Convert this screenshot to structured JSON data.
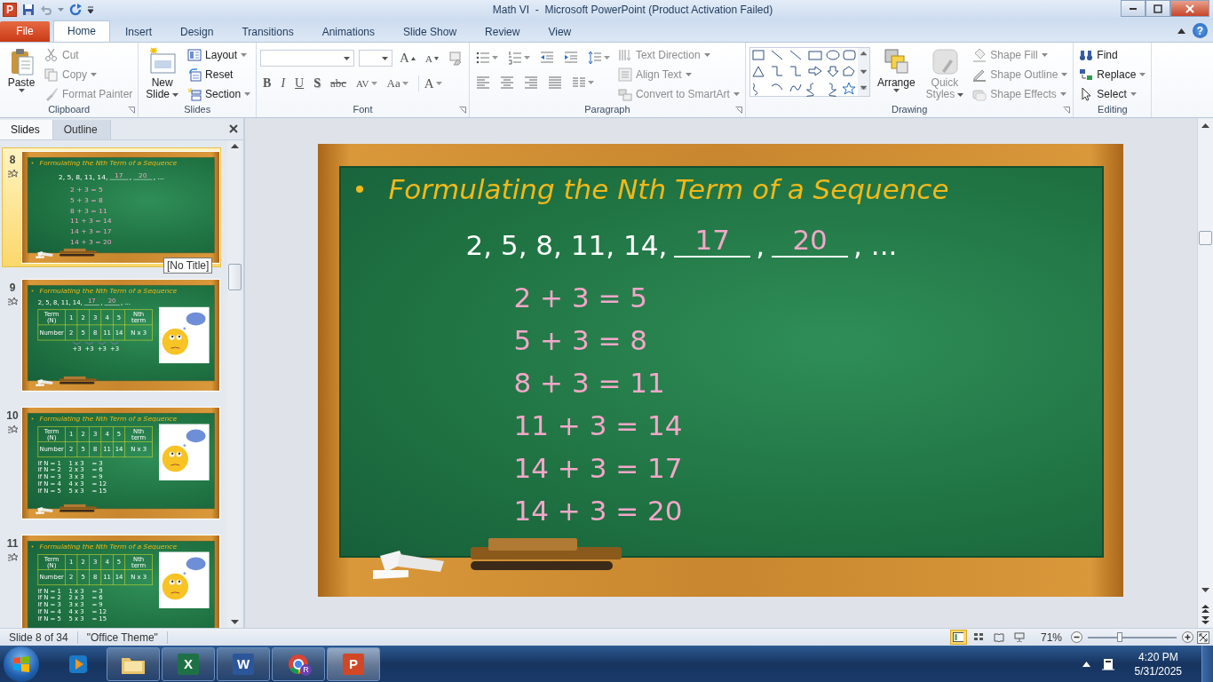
{
  "window": {
    "title": "Math VI  -  Microsoft PowerPoint (Product Activation Failed)",
    "app_glyph": "P"
  },
  "tabs": [
    {
      "label": "File",
      "kind": "file",
      "selected": false
    },
    {
      "label": "Home",
      "kind": "tab",
      "selected": true
    },
    {
      "label": "Insert",
      "kind": "tab",
      "selected": false
    },
    {
      "label": "Design",
      "kind": "tab",
      "selected": false
    },
    {
      "label": "Transitions",
      "kind": "tab",
      "selected": false
    },
    {
      "label": "Animations",
      "kind": "tab",
      "selected": false
    },
    {
      "label": "Slide Show",
      "kind": "tab",
      "selected": false
    },
    {
      "label": "Review",
      "kind": "tab",
      "selected": false
    },
    {
      "label": "View",
      "kind": "tab",
      "selected": false
    }
  ],
  "help": "?",
  "ribbon": [
    {
      "label": "Clipboard",
      "dialog_launcher": true,
      "columns": [
        {
          "kind": "large",
          "items": [
            {
              "label": "Paste",
              "disabled": false,
              "dropdown": true
            }
          ]
        },
        {
          "kind": "stack",
          "items": [
            {
              "label": "Cut",
              "disabled": true,
              "dropdown": false
            },
            {
              "label": "Copy",
              "disabled": true,
              "dropdown": true
            },
            {
              "label": "Format Painter",
              "disabled": true,
              "dropdown": false
            }
          ]
        }
      ]
    },
    {
      "label": "Slides",
      "dialog_launcher": false,
      "columns": [
        {
          "kind": "large",
          "items": [
            {
              "label": "New Slide",
              "disabled": false,
              "dropdown": true
            }
          ]
        },
        {
          "kind": "stack",
          "items": [
            {
              "label": "Layout",
              "disabled": false,
              "dropdown": true
            },
            {
              "label": "Reset",
              "disabled": false,
              "dropdown": false
            },
            {
              "label": "Section",
              "disabled": false,
              "dropdown": true
            }
          ]
        }
      ]
    },
    {
      "label": "Font",
      "dialog_launcher": true,
      "columns": [
        {
          "kind": "rows",
          "rows": [
            {
              "items": [
                {
                  "kind": "font-combo",
                  "dropdown": true
                },
                {
                  "kind": "size-combo",
                  "dropdown": true
                },
                {
                  "kind": "grow",
                  "label": "A",
                  "dropdown": false
                },
                {
                  "kind": "shrink",
                  "label": "A",
                  "dropdown": false
                },
                {
                  "kind": "clear",
                  "dropdown": false
                }
              ]
            },
            {
              "items": [
                {
                  "kind": "bold",
                  "label": "B",
                  "dropdown": false
                },
                {
                  "kind": "italic",
                  "label": "I",
                  "dropdown": false
                },
                {
                  "kind": "underline",
                  "label": "U",
                  "dropdown": false
                },
                {
                  "kind": "shadow",
                  "label": "S",
                  "dropdown": false
                },
                {
                  "kind": "strike",
                  "label": "abc",
                  "dropdown": false
                },
                {
                  "kind": "spacing",
                  "label": "AV",
                  "dropdown": true
                },
                {
                  "kind": "case",
                  "label": "Aa",
                  "dropdown": true
                },
                {
                  "kind": "color",
                  "label": "A",
                  "dropdown": true
                }
              ]
            }
          ]
        }
      ]
    },
    {
      "label": "Paragraph",
      "dialog_launcher": true,
      "columns": [
        {
          "kind": "rows",
          "rows": [
            {
              "items": [
                {
                  "kind": "bullets",
                  "dropdown": true
                },
                {
                  "kind": "numbering",
                  "dropdown": true
                },
                {
                  "kind": "outdent",
                  "dropdown": false
                },
                {
                  "kind": "indent",
                  "dropdown": false
                },
                {
                  "kind": "line-spacing",
                  "dropdown": true
                }
              ]
            },
            {
              "items": [
                {
                  "kind": "align-left",
                  "dropdown": false
                },
                {
                  "kind": "center",
                  "dropdown": false
                },
                {
                  "kind": "align-right",
                  "dropdown": false
                },
                {
                  "kind": "justify",
                  "dropdown": false
                },
                {
                  "kind": "columns",
                  "dropdown": true
                }
              ]
            }
          ]
        },
        {
          "kind": "stack",
          "items": [
            {
              "label": "Text Direction",
              "disabled": true,
              "dropdown": true
            },
            {
              "label": "Align Text",
              "disabled": true,
              "dropdown": true
            },
            {
              "label": "Convert to SmartArt",
              "disabled": true,
              "dropdown": true
            }
          ]
        }
      ]
    },
    {
      "label": "Drawing",
      "dialog_launcher": true,
      "columns": [
        {
          "kind": "gallery"
        },
        {
          "kind": "large",
          "items": [
            {
              "label": "Arrange",
              "disabled": false,
              "dropdown": true
            }
          ]
        },
        {
          "kind": "large",
          "items": [
            {
              "label": "Quick Styles",
              "disabled": true,
              "dropdown": true
            }
          ]
        },
        {
          "kind": "stack",
          "items": [
            {
              "label": "Shape Fill",
              "disabled": true,
              "dropdown": true
            },
            {
              "label": "Shape Outline",
              "disabled": true,
              "dropdown": true
            },
            {
              "label": "Shape Effects",
              "disabled": true,
              "dropdown": true
            }
          ]
        }
      ]
    },
    {
      "label": "Editing",
      "dialog_launcher": false,
      "columns": [
        {
          "kind": "stack",
          "items": [
            {
              "label": "Find",
              "disabled": false,
              "dropdown": false
            },
            {
              "label": "Replace",
              "disabled": false,
              "dropdown": true
            },
            {
              "label": "Select",
              "disabled": false,
              "dropdown": true
            }
          ]
        }
      ]
    }
  ],
  "slide_pane": {
    "tabs": [
      {
        "label": "Slides",
        "selected": true
      },
      {
        "label": "Outline",
        "selected": false
      }
    ],
    "tooltip": "[No Title]",
    "thumbnails": [
      {
        "number": "8",
        "selected": true,
        "slide": {
          "kind": "equations",
          "title": "Formulating  the Nth Term of a Sequence",
          "sequence": [
            {
              "kind": "text",
              "text": "2, 5, 8, 11, 14,"
            },
            {
              "kind": "blank",
              "text": "17"
            },
            {
              "kind": "text",
              "text": ","
            },
            {
              "kind": "blank",
              "text": "20"
            },
            {
              "kind": "text",
              "text": ", ..."
            }
          ],
          "lines": [
            "2 + 3 = 5",
            "5 + 3 = 8",
            "8 + 3 = 11",
            "11 + 3 = 14",
            "14 + 3 = 17",
            "14 + 3 = 20"
          ]
        }
      },
      {
        "number": "9",
        "selected": false,
        "slide": {
          "kind": "table",
          "title": "Formulating  the Nth Term of a Sequence",
          "sequence": [
            {
              "kind": "text",
              "text": "2, 5, 8, 11, 14,"
            },
            {
              "kind": "blank",
              "text": "17"
            },
            {
              "kind": "text",
              "text": ","
            },
            {
              "kind": "blank",
              "text": "20"
            },
            {
              "kind": "text",
              "text": ", ..."
            }
          ],
          "table": [
            [
              "Term (N)",
              "1",
              "2",
              "3",
              "4",
              "5",
              "Nth term"
            ],
            [
              "Number",
              "2",
              "5",
              "8",
              "11",
              "14",
              "N x 3"
            ]
          ],
          "steps": [
            "+3",
            "+3",
            "+3",
            "+3"
          ]
        }
      },
      {
        "number": "10",
        "selected": false,
        "slide": {
          "kind": "table",
          "title": "Formulating  the Nth Term of a Sequence",
          "table": [
            [
              "Term (N)",
              "1",
              "2",
              "3",
              "4",
              "5",
              "Nth term"
            ],
            [
              "Number",
              "2",
              "5",
              "8",
              "11",
              "14",
              "N x 3"
            ]
          ],
          "lines": [
            "If N = 1    1 x 3    = 3",
            "If N = 2    2 x 3    = 6",
            "If N = 3    3 x 3    = 9",
            "If N = 4    4 x 3    = 12",
            "If N = 5    5 x 3    = 15"
          ]
        }
      },
      {
        "number": "11",
        "selected": false,
        "slide": {
          "kind": "table",
          "title": "Formulating  the Nth Term of a Sequence",
          "table": [
            [
              "Term (N)",
              "1",
              "2",
              "3",
              "4",
              "5",
              "Nth term"
            ],
            [
              "Number",
              "2",
              "5",
              "8",
              "11",
              "14",
              "N x 3"
            ]
          ],
          "lines": [
            "If N = 1    1 x 3    = 3",
            "If N = 2    2 x 3    = 6",
            "If N = 3    3 x 3    = 9",
            "If N = 4    4 x 3    = 12",
            "If N = 5    5 x 3    = 15"
          ]
        }
      }
    ]
  },
  "editor": {
    "slide": {
      "kind": "equations",
      "title": "Formulating the Nth Term of a Sequence",
      "sequence": [
        {
          "kind": "text",
          "text": "2, 5, 8, 11, 14,"
        },
        {
          "kind": "blank",
          "text": "17"
        },
        {
          "kind": "text",
          "text": ","
        },
        {
          "kind": "blank",
          "text": "20"
        },
        {
          "kind": "text",
          "text": ", ..."
        }
      ],
      "lines": [
        "2 + 3 = 5",
        "5 + 3 = 8",
        "8 + 3 = 11",
        "11 + 3 = 14",
        "14 + 3 = 17",
        "14 + 3 = 20"
      ]
    }
  },
  "status_bar": {
    "slide_info": "Slide 8 of 34",
    "theme": "\"Office Theme\"",
    "views": [
      {
        "selected": true
      },
      {
        "selected": false
      },
      {
        "selected": false
      },
      {
        "selected": false
      }
    ],
    "zoom": "71%",
    "zoom_slider": {
      "level": 0.36
    }
  },
  "taskbar": {
    "apps": [
      {
        "kind": "media",
        "running": false,
        "active": false
      },
      {
        "kind": "folder",
        "running": true,
        "active": false
      },
      {
        "kind": "excel",
        "glyph": "X",
        "running": true,
        "active": false
      },
      {
        "kind": "word",
        "glyph": "W",
        "running": true,
        "active": false
      },
      {
        "kind": "chrome",
        "badge": "R",
        "running": true,
        "active": false
      },
      {
        "kind": "powerpoint",
        "glyph": "P",
        "running": true,
        "active": true
      }
    ],
    "time": "4:20 PM",
    "date": "5/31/2025"
  }
}
